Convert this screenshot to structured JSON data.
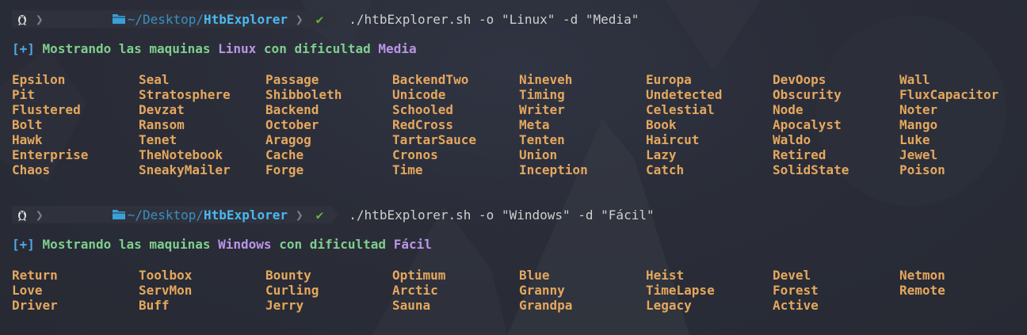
{
  "colors": {
    "background": "#2a2d38",
    "machine_name": "#e5a75e",
    "info_green": "#7fcf8e",
    "info_purple": "#b995e8",
    "path_blue": "#4bb8f0",
    "check_green": "#63b33b"
  },
  "icons": {
    "os": "linux-tux-icon",
    "folder": "folder-icon",
    "status": "check-icon"
  },
  "blocks": [
    {
      "prompt": {
        "path_home": "~/Desktop/",
        "path_dir": "HtbExplorer",
        "check": "✔",
        "command": "./htbExplorer.sh -o \"Linux\" -d \"Media\""
      },
      "info": {
        "prefix": "[+]",
        "text1": "Mostrando las maquinas",
        "os": "Linux",
        "text2": "con dificultad",
        "difficulty": "Media"
      },
      "machines": [
        "Epsilon",
        "Seal",
        "Passage",
        "BackendTwo",
        "Nineveh",
        "Europa",
        "DevOops",
        "Wall",
        "Pit",
        "Stratosphere",
        "Shibboleth",
        "Unicode",
        "Timing",
        "Undetected",
        "Obscurity",
        "FluxCapacitor",
        "Flustered",
        "Devzat",
        "Backend",
        "Schooled",
        "Writer",
        "Celestial",
        "Node",
        "Noter",
        "Bolt",
        "Ransom",
        "October",
        "RedCross",
        "Meta",
        "Book",
        "Apocalyst",
        "Mango",
        "Hawk",
        "Tenet",
        "Aragog",
        "TartarSauce",
        "Tenten",
        "Haircut",
        "Waldo",
        "Luke",
        "Enterprise",
        "TheNotebook",
        "Cache",
        "Cronos",
        "Union",
        "Lazy",
        "Retired",
        "Jewel",
        "Chaos",
        "SneakyMailer",
        "Forge",
        "Time",
        "Inception",
        "Catch",
        "SolidState",
        "Poison"
      ]
    },
    {
      "prompt": {
        "path_home": "~/Desktop/",
        "path_dir": "HtbExplorer",
        "check": "✔",
        "command": "./htbExplorer.sh -o \"Windows\" -d \"Fácil\""
      },
      "info": {
        "prefix": "[+]",
        "text1": "Mostrando las maquinas",
        "os": "Windows",
        "text2": "con dificultad",
        "difficulty": "Fácil"
      },
      "machines": [
        "Return",
        "Toolbox",
        "Bounty",
        "Optimum",
        "Blue",
        "Heist",
        "Devel",
        "Netmon",
        "Love",
        "ServMon",
        "Curling",
        "Arctic",
        "Granny",
        "TimeLapse",
        "Forest",
        "Remote",
        "Driver",
        "Buff",
        "Jerry",
        "Sauna",
        "Grandpa",
        "Legacy",
        "Active"
      ]
    }
  ]
}
